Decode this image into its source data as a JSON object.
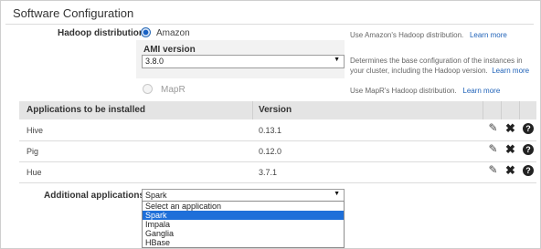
{
  "section": {
    "title": "Software Configuration"
  },
  "hadoop": {
    "label": "Hadoop distribution",
    "amazon": {
      "label": "Amazon",
      "selected": true,
      "help": "Use Amazon's Hadoop distribution.",
      "learn_more": "Learn more"
    },
    "ami": {
      "label": "AMI version",
      "value": "3.8.0",
      "help_line1": "Determines the base configuration of the instances in",
      "help_line2": "your cluster, including the Hadoop version.",
      "learn_more": "Learn more"
    },
    "mapr": {
      "label": "MapR",
      "selected": false,
      "help": "Use MapR's Hadoop distribution.",
      "learn_more": "Learn more"
    }
  },
  "apps_table": {
    "columns": [
      "Applications to be installed",
      "Version"
    ],
    "rows": [
      {
        "name": "Hive",
        "version": "0.13.1"
      },
      {
        "name": "Pig",
        "version": "0.12.0"
      },
      {
        "name": "Hue",
        "version": "3.7.1"
      }
    ],
    "row_icons": [
      "pencil-icon",
      "close-icon",
      "help-icon"
    ]
  },
  "additional": {
    "label": "Additional applications",
    "value": "Spark",
    "options": [
      "Select an application",
      "Spark",
      "Impala",
      "Ganglia",
      "HBase"
    ],
    "highlighted": "Spark"
  },
  "colors": {
    "link": "#1f62b8",
    "selected_option": "#1e6fd9",
    "header_bg": "#e4e4e4"
  }
}
